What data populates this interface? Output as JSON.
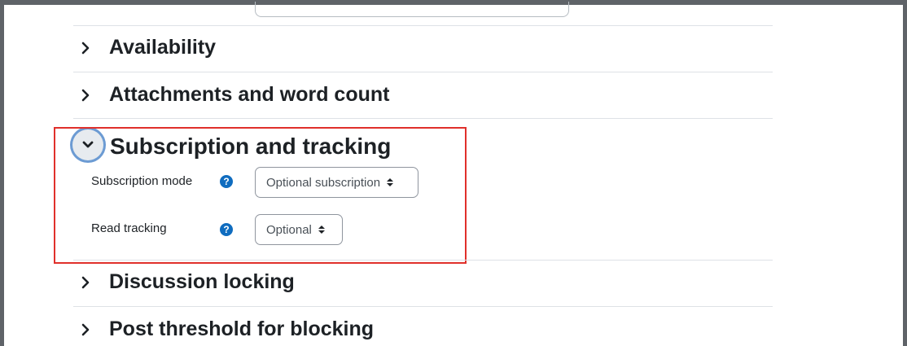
{
  "sections": {
    "availability": "Availability",
    "attachments": "Attachments and word count",
    "subscription": "Subscription and tracking",
    "discussion_locking": "Discussion locking",
    "post_threshold": "Post threshold for blocking"
  },
  "fields": {
    "subscription_mode": {
      "label": "Subscription mode",
      "value": "Optional subscription"
    },
    "read_tracking": {
      "label": "Read tracking",
      "value": "Optional"
    }
  },
  "help_glyph": "?",
  "colors": {
    "frame": "#5f6368",
    "text": "#1d2125",
    "help_icon": "#0f6cbf",
    "highlight": "#e0302b",
    "focus_ring": "#6c9bd3"
  },
  "icons": {
    "collapsed": "chevron-right-icon",
    "expanded": "chevron-down-icon",
    "help": "question-circle-icon",
    "select": "sort-caret-icon"
  }
}
